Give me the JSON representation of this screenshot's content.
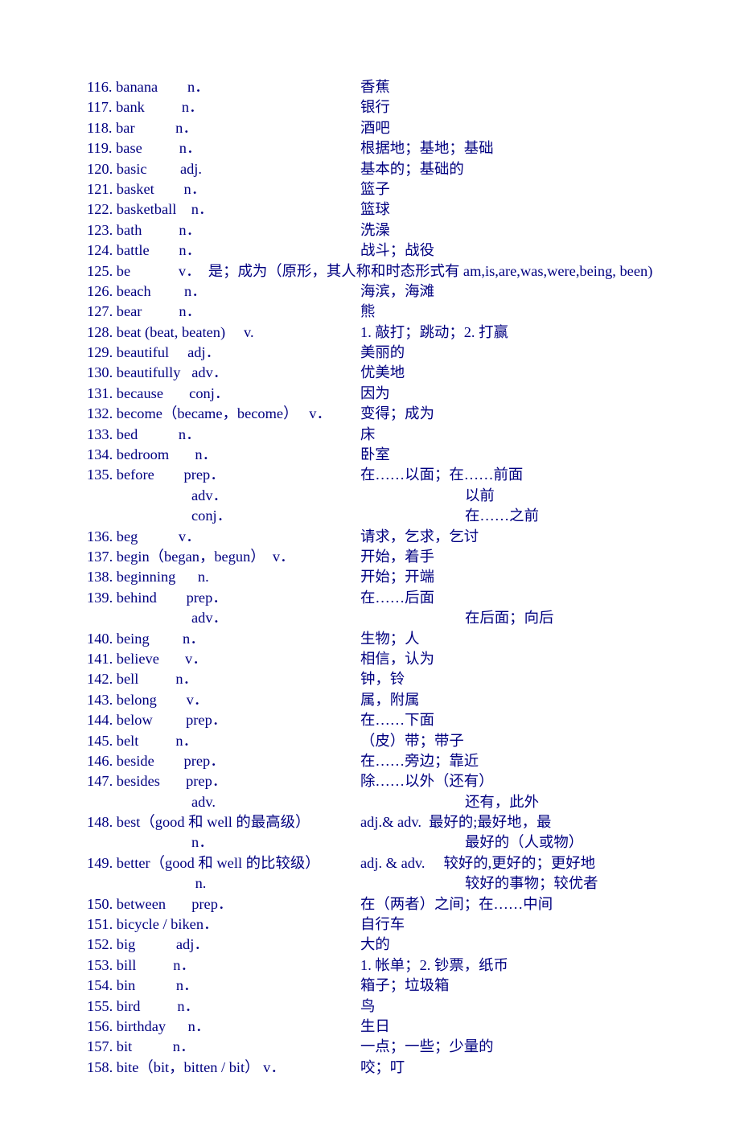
{
  "rows": [
    {
      "num": "116",
      "word": "banana",
      "pos": "n．",
      "def": "香蕉"
    },
    {
      "num": "117",
      "word": "bank",
      "pos": "n．",
      "def": "银行"
    },
    {
      "num": "118",
      "word": "bar",
      "pos": "n．",
      "def": "酒吧"
    },
    {
      "num": "119",
      "word": "base",
      "pos": "n．",
      "def": "根据地；基地；基础"
    },
    {
      "num": "120",
      "word": "basic",
      "pos": "adj.",
      "def": "基本的；基础的"
    },
    {
      "num": "121",
      "word": "basket",
      "pos": "n．",
      "def": "篮子"
    },
    {
      "num": "122",
      "word": "basketball",
      "pos": "n．",
      "def": "篮球"
    },
    {
      "num": "123",
      "word": "bath",
      "pos": "n．",
      "def": "洗澡"
    },
    {
      "num": "124",
      "word": "battle",
      "pos": "n．",
      "def": "战斗；战役"
    },
    {
      "num": "125",
      "word": "be",
      "pos": "v．  是；成为（原形，其人称和时态形式有 am,is,are,was,were,being, been)",
      "def": "",
      "full": true
    },
    {
      "num": "126",
      "word": "beach",
      "pos": "n．",
      "def": "海滨，海滩"
    },
    {
      "num": "127",
      "word": "bear",
      "pos": "n．",
      "def": "熊"
    },
    {
      "num": "128",
      "word": "beat (beat, beaten)",
      "pos": "v.",
      "posPad": 5,
      "def": "1. 敲打；跳动；2. 打赢"
    },
    {
      "num": "129",
      "word": "beautiful",
      "pos": "adj．",
      "def": "美丽的"
    },
    {
      "num": "130",
      "word": "beautifully",
      "pos": "adv．",
      "def": "优美地"
    },
    {
      "num": "131",
      "word": "because",
      "pos": "conj．",
      "def": "因为"
    },
    {
      "num": "132",
      "word": "become（became，become）",
      "pos": "v．",
      "posPad": 0,
      "def": "变得；成为"
    },
    {
      "num": "133",
      "word": "bed",
      "pos": "n．",
      "def": "床"
    },
    {
      "num": "134",
      "word": "bedroom",
      "pos": "n．",
      "def": "卧室"
    },
    {
      "num": "135",
      "word": "before",
      "pos": "prep．",
      "def": "在……以面；在……前面"
    },
    {
      "cont": true,
      "pos": "adv．",
      "def": "以前"
    },
    {
      "cont": true,
      "pos": "conj．",
      "def": "在……之前"
    },
    {
      "num": "136",
      "word": "beg",
      "pos": "v．",
      "def": "请求，乞求，乞讨"
    },
    {
      "num": "137",
      "word": "begin（began，begun）",
      "pos": "v．",
      "posPad": 2,
      "def": "开始，着手"
    },
    {
      "num": "138",
      "word": "beginning",
      "pos": " n.",
      "def": "开始；开端"
    },
    {
      "num": "139",
      "word": "behind",
      "pos": "prep．",
      "def": "在……后面"
    },
    {
      "cont": true,
      "pos": "adv．",
      "def": "在后面；向后"
    },
    {
      "num": "140",
      "word": "being",
      "pos": "n．",
      "def": "生物；人"
    },
    {
      "num": "141",
      "word": "believe",
      "pos": "v．",
      "def": "相信，认为"
    },
    {
      "num": "142",
      "word": "bell",
      "pos": "n．",
      "def": "钟，铃"
    },
    {
      "num": "143",
      "word": "belong",
      "pos": "v．",
      "def": "属，附属"
    },
    {
      "num": "144",
      "word": "below",
      "pos": "prep．",
      "def": "在……下面"
    },
    {
      "num": "145",
      "word": "belt",
      "pos": "n．",
      "def": "（皮）带；带子"
    },
    {
      "num": "146",
      "word": "beside",
      "pos": "prep．",
      "def": "在……旁边；靠近"
    },
    {
      "num": "147",
      "word": "besides",
      "pos": "prep．",
      "def": "除……以外（还有）"
    },
    {
      "cont": true,
      "pos": "adv.",
      "def": "还有，此外"
    },
    {
      "num": "148",
      "word": "best（good 和 well 的最高级）",
      "pos": "",
      "posPad": 0,
      "def": "adj.& adv.  最好的;最好地，最"
    },
    {
      "cont": true,
      "pos": "n．",
      "def": "最好的（人或物）"
    },
    {
      "num": "149",
      "word": "better（good 和 well 的比较级）",
      "pos": "",
      "posPad": 0,
      "def": "adj. & adv.     较好的,更好的；更好地"
    },
    {
      "cont": true,
      "pos": " n.",
      "def": "较好的事物；较优者"
    },
    {
      "num": "150",
      "word": "between",
      "pos": "prep．",
      "def": "在（两者）之间；在……中间"
    },
    {
      "num": "151",
      "word": "bicycle / bike",
      "pos": "n．",
      "def": "自行车"
    },
    {
      "num": "152",
      "word": "big",
      "pos": "adj．",
      "def": "大的"
    },
    {
      "num": "153",
      "word": "bill",
      "pos": "n．",
      "def": "1. 帐单；2. 钞票，纸币"
    },
    {
      "num": "154",
      "word": "bin",
      "pos": "n．",
      "def": "箱子；垃圾箱"
    },
    {
      "num": "155",
      "word": "bird",
      "pos": "n．",
      "def": "鸟"
    },
    {
      "num": "156",
      "word": "birthday",
      "pos": "n．",
      "def": "生日"
    },
    {
      "num": "157",
      "word": "bit",
      "pos": "n．",
      "def": "一点；一些；少量的"
    },
    {
      "num": "158",
      "word": "bite（bit，bitten / bit）",
      "pos": "v．",
      "posPad": 1,
      "def": "咬；叮"
    }
  ]
}
